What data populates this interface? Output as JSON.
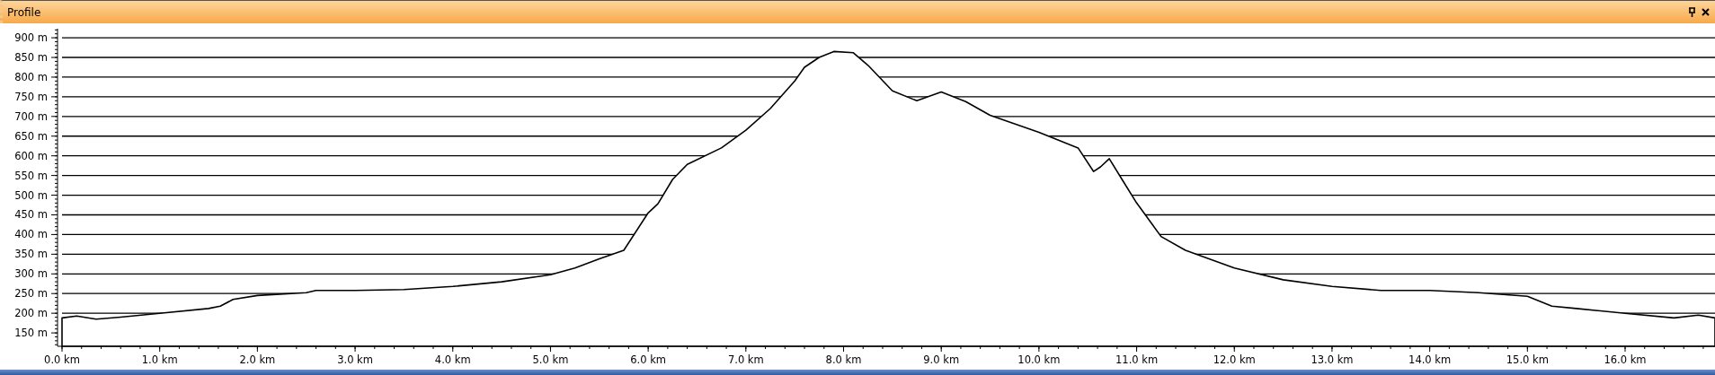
{
  "panel": {
    "title": "Profile",
    "buttons": [
      {
        "kind": "pin"
      },
      {
        "kind": "close"
      }
    ]
  },
  "chart_data": {
    "type": "area",
    "grid": true,
    "xlim": [
      0,
      16.92
    ],
    "ylim": [
      116,
      923
    ],
    "xticks": [
      {
        "value": 0,
        "label": "0.0 km"
      },
      {
        "value": 1,
        "label": "1.0 km"
      },
      {
        "value": 2,
        "label": "2.0 km"
      },
      {
        "value": 3,
        "label": "3.0 km"
      },
      {
        "value": 4,
        "label": "4.0 km"
      },
      {
        "value": 5,
        "label": "5.0 km"
      },
      {
        "value": 6,
        "label": "6.0 km"
      },
      {
        "value": 7,
        "label": "7.0 km"
      },
      {
        "value": 8,
        "label": "8.0 km"
      },
      {
        "value": 9,
        "label": "9.0 km"
      },
      {
        "value": 10,
        "label": "10.0 km"
      },
      {
        "value": 11,
        "label": "11.0 km"
      },
      {
        "value": 12,
        "label": "12.0 km"
      },
      {
        "value": 13,
        "label": "13.0 km"
      },
      {
        "value": 14,
        "label": "14.0 km"
      },
      {
        "value": 15,
        "label": "15.0 km"
      },
      {
        "value": 16,
        "label": "16.0 km"
      }
    ],
    "yticks": [
      {
        "value": 150,
        "label": "150 m"
      },
      {
        "value": 200,
        "label": "200 m"
      },
      {
        "value": 250,
        "label": "250 m"
      },
      {
        "value": 300,
        "label": "300 m"
      },
      {
        "value": 350,
        "label": "350 m"
      },
      {
        "value": 400,
        "label": "400 m"
      },
      {
        "value": 450,
        "label": "450 m"
      },
      {
        "value": 500,
        "label": "500 m"
      },
      {
        "value": 550,
        "label": "550 m"
      },
      {
        "value": 600,
        "label": "600 m"
      },
      {
        "value": 650,
        "label": "650 m"
      },
      {
        "value": 700,
        "label": "700 m"
      },
      {
        "value": 750,
        "label": "750 m"
      },
      {
        "value": 800,
        "label": "800 m"
      },
      {
        "value": 850,
        "label": "850 m"
      },
      {
        "value": 900,
        "label": "900 m"
      }
    ],
    "x": [
      0,
      0.15,
      0.35,
      0.6,
      1.0,
      1.5,
      1.62,
      1.75,
      2.0,
      2.5,
      2.6,
      3.0,
      3.5,
      4.0,
      4.5,
      5.0,
      5.25,
      5.5,
      5.75,
      6.0,
      6.1,
      6.25,
      6.4,
      6.75,
      7.0,
      7.25,
      7.5,
      7.6,
      7.75,
      7.9,
      8.1,
      8.25,
      8.5,
      8.75,
      9.0,
      9.25,
      9.5,
      10.0,
      10.4,
      10.56,
      10.63,
      10.72,
      10.85,
      11.0,
      11.25,
      11.5,
      12.0,
      12.5,
      13.0,
      13.5,
      14.0,
      14.5,
      15.0,
      15.25,
      15.5,
      16.0,
      16.5,
      16.75,
      16.92
    ],
    "series": [
      {
        "color": "#000000",
        "values": [
          188,
          193,
          185,
          190,
          200,
          212,
          218,
          235,
          245,
          252,
          258,
          258,
          260,
          268,
          280,
          298,
          315,
          338,
          360,
          455,
          478,
          540,
          578,
          620,
          665,
          720,
          790,
          825,
          850,
          865,
          862,
          830,
          765,
          740,
          762,
          738,
          703,
          660,
          620,
          560,
          572,
          593,
          540,
          480,
          395,
          360,
          315,
          285,
          268,
          258,
          258,
          252,
          243,
          218,
          212,
          200,
          188,
          195,
          188
        ]
      }
    ]
  }
}
